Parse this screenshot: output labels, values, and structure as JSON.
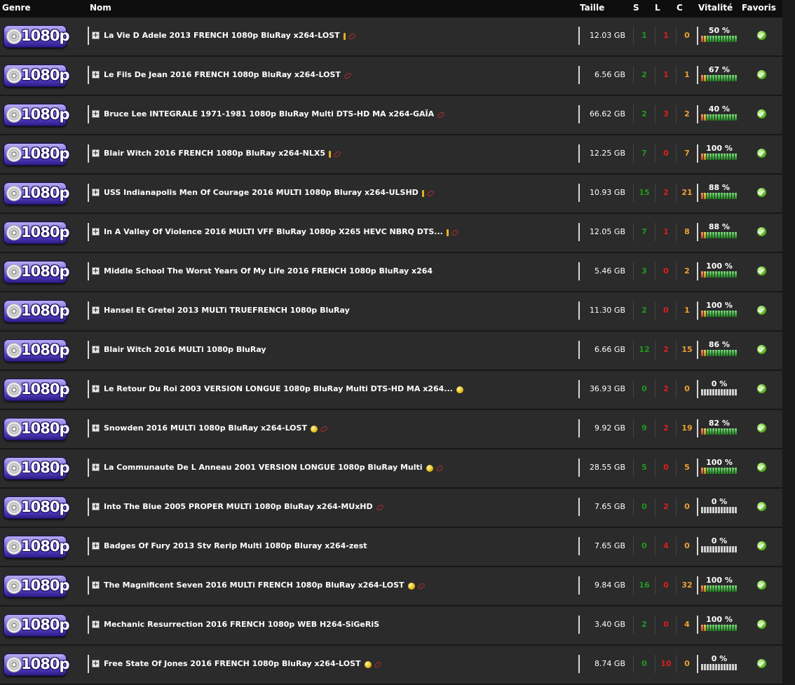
{
  "header": {
    "genre": "Genre",
    "nom": "Nom",
    "taille": "Taille",
    "s": "S",
    "l": "L",
    "c": "C",
    "vitalite": "Vitalité",
    "favoris": "Favoris"
  },
  "genre_badge": "1080p",
  "colors": {
    "seed": "#1f9a1f",
    "leech": "#dd1e1e",
    "complete": "#f0a030",
    "badge": "#5a44c8"
  },
  "rows": [
    {
      "name": "La Vie D Adele 2013 FRENCH 1080p BluRay x264-LOST",
      "icons": [
        "alert-icon",
        "link-icon"
      ],
      "size": "12.03 GB",
      "s": "1",
      "l": "1",
      "c": "0",
      "vitality": "50 %",
      "vitality_value": 50
    },
    {
      "name": "Le Fils De Jean 2016 FRENCH 1080p BluRay x264-LOST",
      "icons": [
        "link-icon"
      ],
      "size": "6.56 GB",
      "s": "2",
      "l": "1",
      "c": "1",
      "vitality": "67 %",
      "vitality_value": 67
    },
    {
      "name": "Bruce Lee INTEGRALE 1971-1981 1080p BluRay Multi DTS-HD MA x264-GAÏA",
      "icons": [
        "link-icon"
      ],
      "size": "66.62 GB",
      "s": "2",
      "l": "3",
      "c": "2",
      "vitality": "40 %",
      "vitality_value": 40
    },
    {
      "name": "Blair Witch 2016 FRENCH 1080p BluRay x264-NLX5",
      "icons": [
        "alert-icon",
        "link-icon"
      ],
      "size": "12.25 GB",
      "s": "7",
      "l": "0",
      "c": "7",
      "vitality": "100 %",
      "vitality_value": 100
    },
    {
      "name": "USS Indianapolis Men Of Courage 2016 MULTI 1080p Bluray x264-ULSHD",
      "icons": [
        "alert-icon",
        "link-icon"
      ],
      "size": "10.93 GB",
      "s": "15",
      "l": "2",
      "c": "21",
      "vitality": "88 %",
      "vitality_value": 88
    },
    {
      "name": "In A Valley Of Violence 2016 MULTI VFF BluRay 1080p X265 HEVC NBRQ DTS...",
      "icons": [
        "alert-icon",
        "link-icon"
      ],
      "size": "12.05 GB",
      "s": "7",
      "l": "1",
      "c": "8",
      "vitality": "88 %",
      "vitality_value": 88
    },
    {
      "name": "Middle School The Worst Years Of My Life 2016 FRENCH 1080p BluRay x264",
      "icons": [],
      "size": "5.46 GB",
      "s": "3",
      "l": "0",
      "c": "2",
      "vitality": "100 %",
      "vitality_value": 100
    },
    {
      "name": "Hansel Et Gretel 2013 MULTi TRUEFRENCH 1080p BluRay",
      "icons": [],
      "size": "11.30 GB",
      "s": "2",
      "l": "0",
      "c": "1",
      "vitality": "100 %",
      "vitality_value": 100
    },
    {
      "name": "Blair Witch 2016 MULTi 1080p BluRay",
      "icons": [],
      "size": "6.66 GB",
      "s": "12",
      "l": "2",
      "c": "15",
      "vitality": "86 %",
      "vitality_value": 86
    },
    {
      "name": "Le Retour Du Roi 2003 VERSION LONGUE 1080p BluRay Multi DTS-HD MA x264...",
      "icons": [
        "coin-icon"
      ],
      "size": "36.93 GB",
      "s": "0",
      "l": "2",
      "c": "0",
      "vitality": "0 %",
      "vitality_value": 0
    },
    {
      "name": "Snowden 2016 MULTi 1080p BluRay x264-LOST",
      "icons": [
        "coin-icon",
        "link-icon"
      ],
      "size": "9.92 GB",
      "s": "9",
      "l": "2",
      "c": "19",
      "vitality": "82 %",
      "vitality_value": 82
    },
    {
      "name": "La Communaute De L Anneau 2001 VERSION LONGUE 1080p BluRay Multi",
      "icons": [
        "coin-icon",
        "link-icon"
      ],
      "size": "28.55 GB",
      "s": "5",
      "l": "0",
      "c": "5",
      "vitality": "100 %",
      "vitality_value": 100
    },
    {
      "name": "Into The Blue 2005 PROPER MULTi 1080p BluRay x264-MUxHD",
      "icons": [
        "link-icon"
      ],
      "size": "7.65 GB",
      "s": "0",
      "l": "2",
      "c": "0",
      "vitality": "0 %",
      "vitality_value": 0
    },
    {
      "name": "Badges Of Fury 2013 Stv Rerip Multi 1080p Bluray x264-zest",
      "icons": [],
      "size": "7.65 GB",
      "s": "0",
      "l": "4",
      "c": "0",
      "vitality": "0 %",
      "vitality_value": 0
    },
    {
      "name": "The Magnificent Seven 2016 MULTi FRENCH 1080p BluRay x264-LOST",
      "icons": [
        "coin-icon",
        "link-icon"
      ],
      "size": "9.84 GB",
      "s": "16",
      "l": "0",
      "c": "32",
      "vitality": "100 %",
      "vitality_value": 100
    },
    {
      "name": "Mechanic Resurrection 2016 FRENCH 1080p WEB H264-SiGeRiS",
      "icons": [],
      "size": "3.40 GB",
      "s": "2",
      "l": "0",
      "c": "4",
      "vitality": "100 %",
      "vitality_value": 100
    },
    {
      "name": "Free State Of Jones 2016 FRENCH 1080p BluRay x264-LOST",
      "icons": [
        "coin-icon",
        "link-icon"
      ],
      "size": "8.74 GB",
      "s": "0",
      "l": "10",
      "c": "0",
      "vitality": "0 %",
      "vitality_value": 0
    }
  ]
}
